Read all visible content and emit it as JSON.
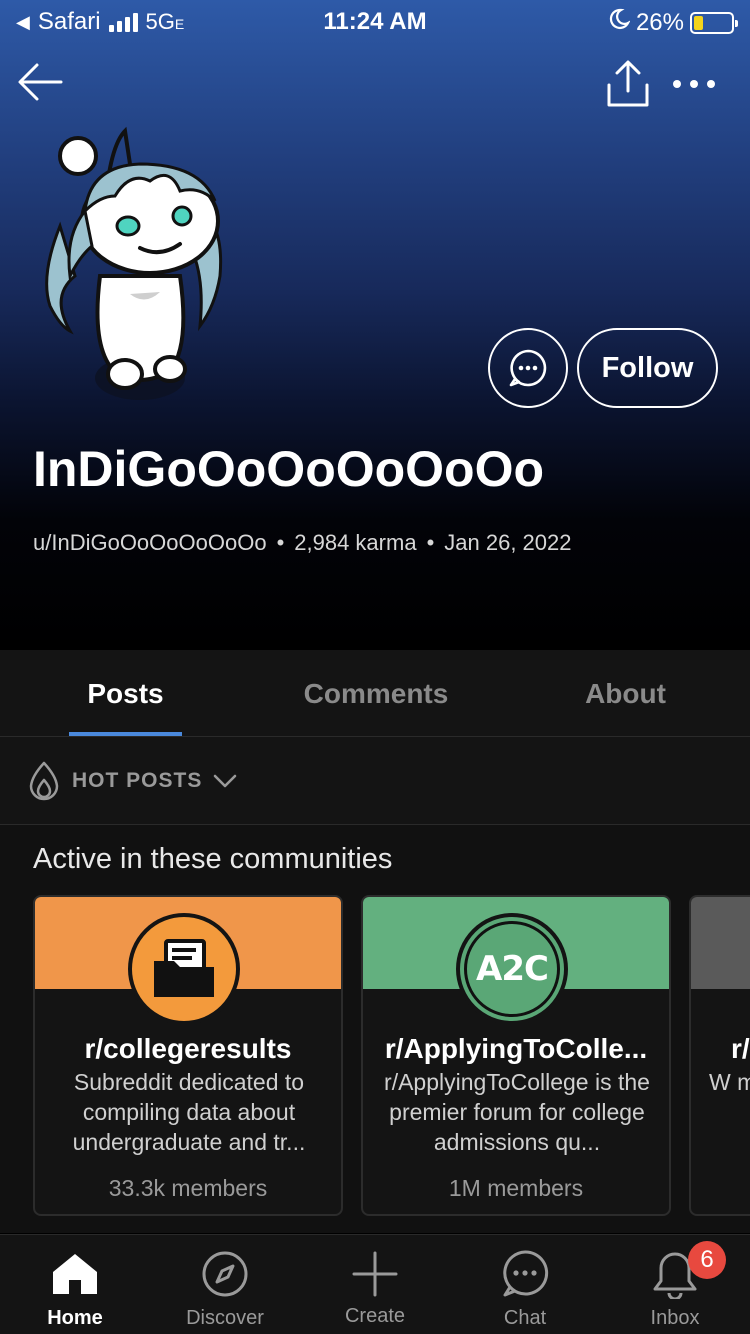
{
  "status_bar": {
    "back_app": "Safari",
    "network": "5G",
    "network_suffix": "E",
    "time": "11:24 AM",
    "battery": "26%",
    "battery_level": 0.26
  },
  "profile": {
    "display_name": "InDiGoOoOoOoOoOo",
    "username": "u/InDiGoOoOoOoOoOo",
    "karma": "2,984 karma",
    "cake_day": "Jan 26, 2022",
    "separator": "•",
    "follow_label": "Follow"
  },
  "tabs": [
    {
      "label": "Posts",
      "active": true
    },
    {
      "label": "Comments",
      "active": false
    },
    {
      "label": "About",
      "active": false
    }
  ],
  "sort": {
    "label": "HOT POSTS"
  },
  "communities": {
    "title": "Active in these communities",
    "items": [
      {
        "name": "r/collegeresults",
        "desc": "Subreddit dedicated to compiling data about undergraduate and tr...",
        "members": "33.3k members",
        "banner_color": "#f0964a",
        "icon_bg": "#f39a3c"
      },
      {
        "name": "r/ApplyingToColle...",
        "desc": "r/ApplyingToCollege is the premier forum for college admissions qu...",
        "members": "1M members",
        "banner_color": "#63b07f",
        "icon_bg": "#5aa776",
        "icon_text": "A2C"
      },
      {
        "name": "r/",
        "desc": "W mu com",
        "members": "",
        "banner_color": "#5a5a5a"
      }
    ]
  },
  "bottom_nav": [
    {
      "label": "Home",
      "icon": "home-icon",
      "active": true
    },
    {
      "label": "Discover",
      "icon": "compass-icon",
      "active": false
    },
    {
      "label": "Create",
      "icon": "plus-icon",
      "active": false
    },
    {
      "label": "Chat",
      "icon": "chat-icon",
      "active": false
    },
    {
      "label": "Inbox",
      "icon": "bell-icon",
      "active": false,
      "badge": "6"
    }
  ],
  "colors": {
    "accent": "#4a89dc",
    "badge": "#e8493f",
    "header_top": "#2e5aa8"
  }
}
